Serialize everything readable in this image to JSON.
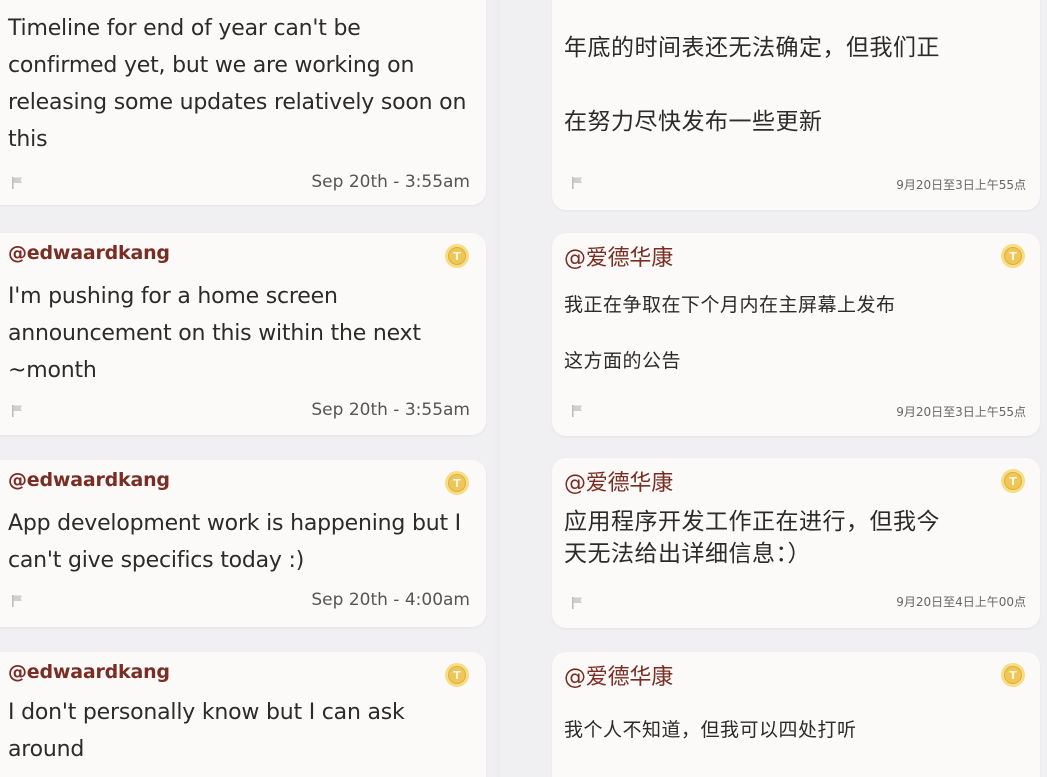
{
  "left_column": {
    "cards": [
      {
        "message": "Timeline for end of year can't be\nconfirmed yet, but we are working on\nreleasing some updates relatively soon on\nthis",
        "timestamp": "Sep 20th - 3:55am"
      },
      {
        "author": "@edwaardkang",
        "message": "I'm pushing for a home screen\nannouncement on this within the next\n~month",
        "timestamp": "Sep 20th - 3:55am"
      },
      {
        "author": "@edwaardkang",
        "message": "App development work is happening but I\ncan't give specifics today :)",
        "timestamp": "Sep 20th - 4:00am"
      },
      {
        "author": "@edwaardkang",
        "message": "I don't personally know but I can ask\naround"
      }
    ]
  },
  "right_column": {
    "cards": [
      {
        "message": "年底的时间表还无法确定，但我们正\n\n在努力尽快发布一些更新",
        "timestamp": "9月20日至3日上午55点"
      },
      {
        "author": "@爱德华康",
        "message": "我正在争取在下个月内在主屏幕上发布\n\n这方面的公告",
        "timestamp": "9月20日至3日上午55点"
      },
      {
        "author": "@爱德华康",
        "message": "应用程序开发工作正在进行，但我今\n天无法给出详细信息：）",
        "timestamp": "9月20日至4日上午00点"
      },
      {
        "author": "@爱德华康",
        "message": "我个人不知道，但我可以四处打听"
      }
    ]
  },
  "colors": {
    "background": "#f0eff2",
    "card": "#fbfaf8",
    "author": "#7a2d22",
    "coin": "#e7b93f",
    "flag": "#bdbdbd"
  },
  "icons": [
    "flag-icon",
    "tip-coin-icon"
  ]
}
